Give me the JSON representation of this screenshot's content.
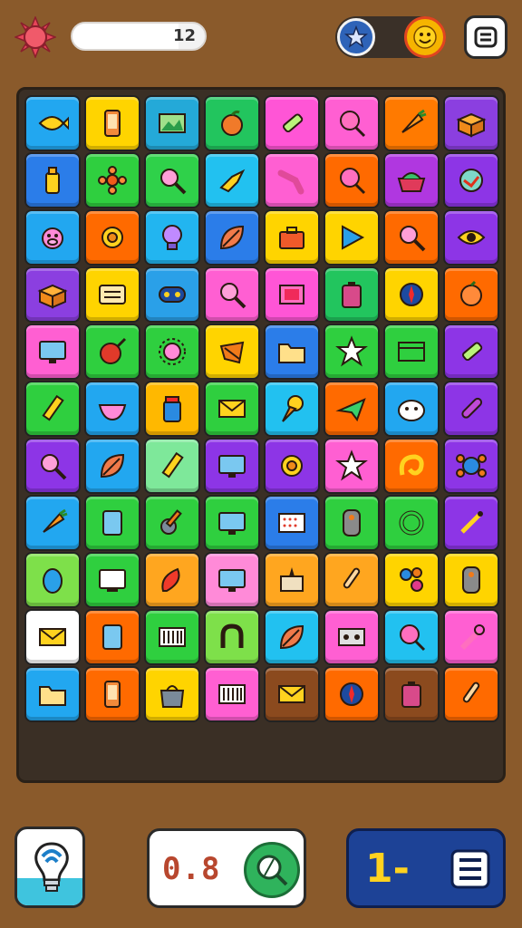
{
  "top_bar": {
    "progress_text": "12",
    "progress_fraction": 0.8,
    "settings_icon": "sun-gear-icon",
    "star_icon": "star-icon",
    "avatar_icon": "smiley-face-icon",
    "menu_icon": "list-menu-icon"
  },
  "board": {
    "rows": 12,
    "cols": 8,
    "tiles": [
      {
        "icon": "fish-icon",
        "color": "#22a7f0"
      },
      {
        "icon": "phone-icon",
        "color": "#ffd400"
      },
      {
        "icon": "picture-icon",
        "color": "#24a9d8"
      },
      {
        "icon": "fruit-icon",
        "color": "#22c55e"
      },
      {
        "icon": "marker-icon",
        "color": "#ff55d6"
      },
      {
        "icon": "lollipop-icon",
        "color": "#ff5fd2"
      },
      {
        "icon": "carrot-icon",
        "color": "#ff7a00"
      },
      {
        "icon": "box-icon",
        "color": "#8b3fe0"
      },
      {
        "icon": "bottle-icon",
        "color": "#2b7de9"
      },
      {
        "icon": "flower-icon",
        "color": "#2fcf3f"
      },
      {
        "icon": "magnifier-icon",
        "color": "#2fd14a"
      },
      {
        "icon": "bird-icon",
        "color": "#22c1f0"
      },
      {
        "icon": "tongue-icon",
        "color": "#ff5fd2"
      },
      {
        "icon": "lollipop-icon",
        "color": "#ff6a00"
      },
      {
        "icon": "basket-icon",
        "color": "#b037e0"
      },
      {
        "icon": "gauge-icon",
        "color": "#8d35e6"
      },
      {
        "icon": "pig-icon",
        "color": "#22a7f0"
      },
      {
        "icon": "gear-icon",
        "color": "#ff6a00"
      },
      {
        "icon": "bulb-icon",
        "color": "#22b5f0"
      },
      {
        "icon": "leaf-icon",
        "color": "#2b7de9"
      },
      {
        "icon": "toolbox-icon",
        "color": "#ffd400"
      },
      {
        "icon": "play-icon",
        "color": "#ffd400"
      },
      {
        "icon": "magnifier-icon",
        "color": "#ff6a00"
      },
      {
        "icon": "eye-icon",
        "color": "#8d35e6"
      },
      {
        "icon": "box-icon",
        "color": "#8b3fe0"
      },
      {
        "icon": "radio-icon",
        "color": "#ffd400"
      },
      {
        "icon": "gamepad-icon",
        "color": "#2aa0e8"
      },
      {
        "icon": "magnifier-icon",
        "color": "#ff5fd2"
      },
      {
        "icon": "frame-icon",
        "color": "#ff55d6"
      },
      {
        "icon": "battery-icon",
        "color": "#22c55e"
      },
      {
        "icon": "compass-icon",
        "color": "#ffd400"
      },
      {
        "icon": "orange-icon",
        "color": "#ff6a00"
      },
      {
        "icon": "monitor-icon",
        "color": "#ff5fd2"
      },
      {
        "icon": "bomb-icon",
        "color": "#2fcf3f"
      },
      {
        "icon": "sun-icon",
        "color": "#2fcf3f"
      },
      {
        "icon": "candy-icon",
        "color": "#ffd400"
      },
      {
        "icon": "folder-icon",
        "color": "#2b7de9"
      },
      {
        "icon": "star-burst-icon",
        "color": "#2fcf3f"
      },
      {
        "icon": "map-icon",
        "color": "#2fcf3f"
      },
      {
        "icon": "marker-icon",
        "color": "#8d35e6"
      },
      {
        "icon": "pencil-icon",
        "color": "#2fcf3f"
      },
      {
        "icon": "bowl-icon",
        "color": "#22a7f0"
      },
      {
        "icon": "jar-icon",
        "color": "#ffb800"
      },
      {
        "icon": "envelope-icon",
        "color": "#2fcf3f"
      },
      {
        "icon": "cone-icon",
        "color": "#22c1f0"
      },
      {
        "icon": "plane-icon",
        "color": "#ff6a00"
      },
      {
        "icon": "cat-face-icon",
        "color": "#22a7f0"
      },
      {
        "icon": "brush-icon",
        "color": "#8d35e6"
      },
      {
        "icon": "magnifier-icon",
        "color": "#8d35e6"
      },
      {
        "icon": "leaf-icon",
        "color": "#22a7f0"
      },
      {
        "icon": "pencil-icon",
        "color": "#7ee89a"
      },
      {
        "icon": "monitor-icon",
        "color": "#8d35e6"
      },
      {
        "icon": "gear-icon",
        "color": "#8d35e6"
      },
      {
        "icon": "star-burst-icon",
        "color": "#ff5fd2"
      },
      {
        "icon": "swirl-icon",
        "color": "#ff6a00"
      },
      {
        "icon": "crab-icon",
        "color": "#8d35e6"
      },
      {
        "icon": "carrot-icon",
        "color": "#22a7f0"
      },
      {
        "icon": "tablet-icon",
        "color": "#2fcf3f"
      },
      {
        "icon": "guitar-icon",
        "color": "#2fcf3f"
      },
      {
        "icon": "monitor-icon",
        "color": "#2fcf3f"
      },
      {
        "icon": "keypad-icon",
        "color": "#2b7de9"
      },
      {
        "icon": "remote-icon",
        "color": "#2fcf3f"
      },
      {
        "icon": "ring-icon",
        "color": "#2fcf3f"
      },
      {
        "icon": "pin-icon",
        "color": "#8d35e6"
      },
      {
        "icon": "egg-icon",
        "color": "#7ee04a"
      },
      {
        "icon": "tv-icon",
        "color": "#2fcf3f"
      },
      {
        "icon": "pepper-icon",
        "color": "#ffa61f"
      },
      {
        "icon": "monitor-icon",
        "color": "#ff8ad8"
      },
      {
        "icon": "cake-icon",
        "color": "#ffa61f"
      },
      {
        "icon": "dropper-icon",
        "color": "#ffa61f"
      },
      {
        "icon": "molecule-icon",
        "color": "#ffd400"
      },
      {
        "icon": "remote-icon",
        "color": "#ffd400"
      },
      {
        "icon": "envelope-icon",
        "color": "#ffffff"
      },
      {
        "icon": "tablet-icon",
        "color": "#ff6a00"
      },
      {
        "icon": "barcode-icon",
        "color": "#2fcf3f"
      },
      {
        "icon": "horseshoe-icon",
        "color": "#7ee04a"
      },
      {
        "icon": "leaf-icon",
        "color": "#22c1f0"
      },
      {
        "icon": "cassette-icon",
        "color": "#ff5fd2"
      },
      {
        "icon": "lollipop-icon",
        "color": "#22c1f0"
      },
      {
        "icon": "wrench-icon",
        "color": "#ff5fd2"
      },
      {
        "icon": "folder-icon",
        "color": "#22a7f0"
      },
      {
        "icon": "phone-icon",
        "color": "#ff6a00"
      },
      {
        "icon": "bag-icon",
        "color": "#ffd400"
      },
      {
        "icon": "barcode-icon",
        "color": "#ff5fd2"
      },
      {
        "icon": "envelope-icon",
        "color": "#8b4a1e"
      },
      {
        "icon": "compass-icon",
        "color": "#ff6a00"
      },
      {
        "icon": "battery-icon",
        "color": "#8b4a1e"
      },
      {
        "icon": "dropper-icon",
        "color": "#ff6a00"
      }
    ]
  },
  "bottom_bar": {
    "hint_icon": "lightbulb-icon",
    "score_text": "0.8",
    "score_icon": "magnifier-icon",
    "level_text": "1-",
    "level_icon": "list-icon"
  }
}
